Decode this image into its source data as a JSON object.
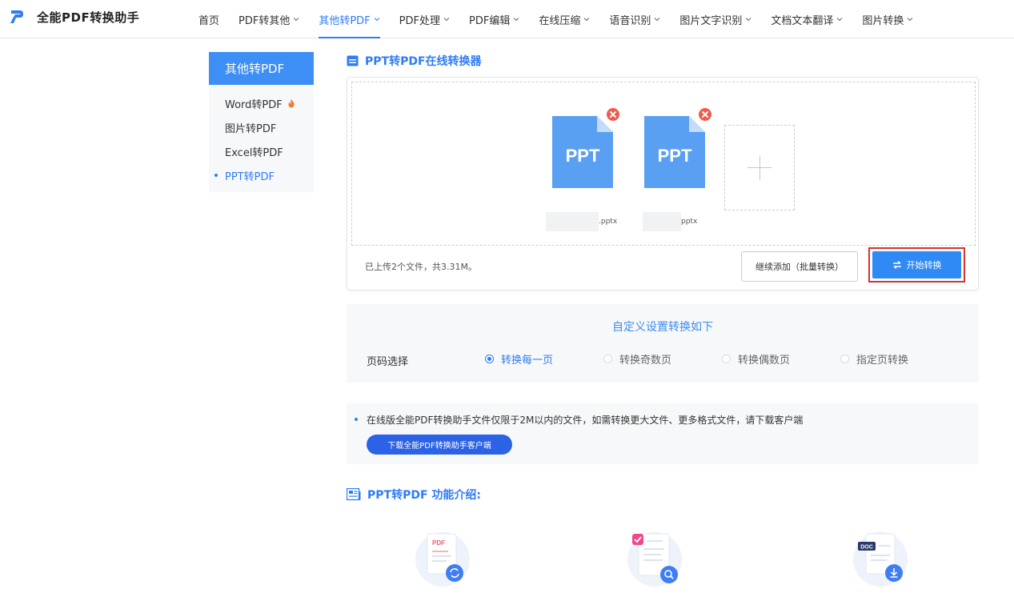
{
  "app": {
    "name": "全能PDF转换助手"
  },
  "nav": [
    {
      "label": "首页",
      "has_dropdown": false
    },
    {
      "label": "PDF转其他",
      "has_dropdown": true
    },
    {
      "label": "其他转PDF",
      "has_dropdown": true,
      "active": true
    },
    {
      "label": "PDF处理",
      "has_dropdown": true
    },
    {
      "label": "PDF编辑",
      "has_dropdown": true
    },
    {
      "label": "在线压缩",
      "has_dropdown": true
    },
    {
      "label": "语音识别",
      "has_dropdown": true
    },
    {
      "label": "图片文字识别",
      "has_dropdown": true
    },
    {
      "label": "文档文本翻译",
      "has_dropdown": true
    },
    {
      "label": "图片转换",
      "has_dropdown": true
    }
  ],
  "sidebar": {
    "title": "其他转PDF",
    "items": [
      {
        "label": "Word转PDF",
        "hot": true
      },
      {
        "label": "图片转PDF"
      },
      {
        "label": "Excel转PDF"
      },
      {
        "label": "PPT转PDF",
        "active": true
      }
    ]
  },
  "converter": {
    "title": "PPT转PDF在线转换器",
    "files": [
      {
        "type_label": "PPT",
        "name_suffix": ".pptx"
      },
      {
        "type_label": "PPT",
        "name_suffix": "pptx"
      }
    ],
    "status": "已上传2个文件，共3.31M。",
    "continue_label": "继续添加（批量转换）",
    "start_label": "开始转换"
  },
  "settings": {
    "title": "自定义设置转换如下",
    "label": "页码选择",
    "options": [
      {
        "label": "转换每一页",
        "checked": true
      },
      {
        "label": "转换奇数页",
        "checked": false
      },
      {
        "label": "转换偶数页",
        "checked": false
      },
      {
        "label": "指定页转换",
        "checked": false
      }
    ]
  },
  "notice": {
    "text": "在线版全能PDF转换助手文件仅限于2M以内的文件，如需转换更大文件、更多格式文件，请下载客户端",
    "download_label": "下载全能PDF转换助手客户端"
  },
  "features": {
    "title": "PPT转PDF 功能介绍:",
    "icons": [
      "pdf-convert-icon",
      "document-search-icon",
      "doc-download-icon"
    ],
    "icon_pdf_label": "PDF",
    "icon_doc_label": "DOC"
  },
  "colors": {
    "brand": "#2f7cf6",
    "sidebar_head": "#3d8ef5",
    "file_blue": "#5aa0f2",
    "highlight_border": "#d93030",
    "remove_red": "#f05a4e"
  }
}
